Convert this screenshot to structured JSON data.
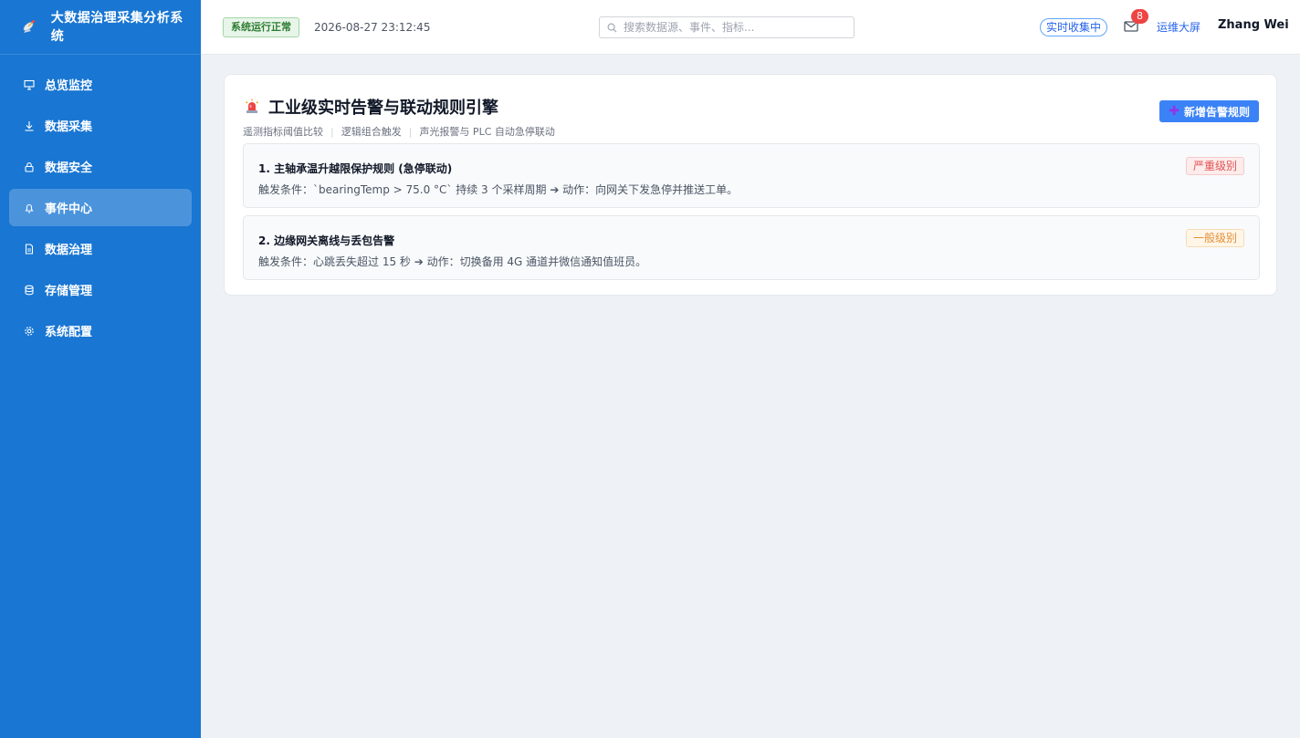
{
  "app": {
    "title": "大数据治理采集分析系统",
    "icon": "satellite-dish-icon"
  },
  "sidebar": {
    "items": [
      {
        "label": "总览监控",
        "icon": "monitor-icon"
      },
      {
        "label": "数据采集",
        "icon": "download-icon"
      },
      {
        "label": "数据安全",
        "icon": "lock-icon"
      },
      {
        "label": "事件中心",
        "icon": "bell-icon",
        "active": true
      },
      {
        "label": "数据治理",
        "icon": "document-icon"
      },
      {
        "label": "存储管理",
        "icon": "database-icon"
      },
      {
        "label": "系统配置",
        "icon": "gear-icon"
      }
    ]
  },
  "header": {
    "status": "系统运行正常",
    "datetime": "2026-08-27 23:12:45",
    "search_placeholder": "搜索数据源、事件、指标...",
    "live_label": "实时收集中",
    "mail_count": "8",
    "ops_link": "运维大屏",
    "user": "Zhang Wei"
  },
  "main": {
    "title": "工业级实时告警与联动规则引擎",
    "subtitles": [
      "遥测指标阈值比较",
      "逻辑组合触发",
      "声光报警与 PLC 自动急停联动"
    ],
    "add_button": "新增告警规则",
    "rules": [
      {
        "title": "1. 主轴承温升越限保护规则 (急停联动)",
        "description": "触发条件：`bearingTemp > 75.0 °C` 持续 3 个采样周期 ➔ 动作：向网关下发急停并推送工单。",
        "level": "严重级别"
      },
      {
        "title": "2. 边缘网关离线与丢包告警",
        "description": "触发条件：心跳丢失超过 15 秒 ➔ 动作：切换备用 4G 通道并微信通知值班员。",
        "level": "一般级别"
      }
    ]
  },
  "colors": {
    "sidebar": "#1976d2",
    "accent": "#3b82f6",
    "severe": "#e05353",
    "normal": "#e1913b",
    "ok": "#2e7d32"
  }
}
